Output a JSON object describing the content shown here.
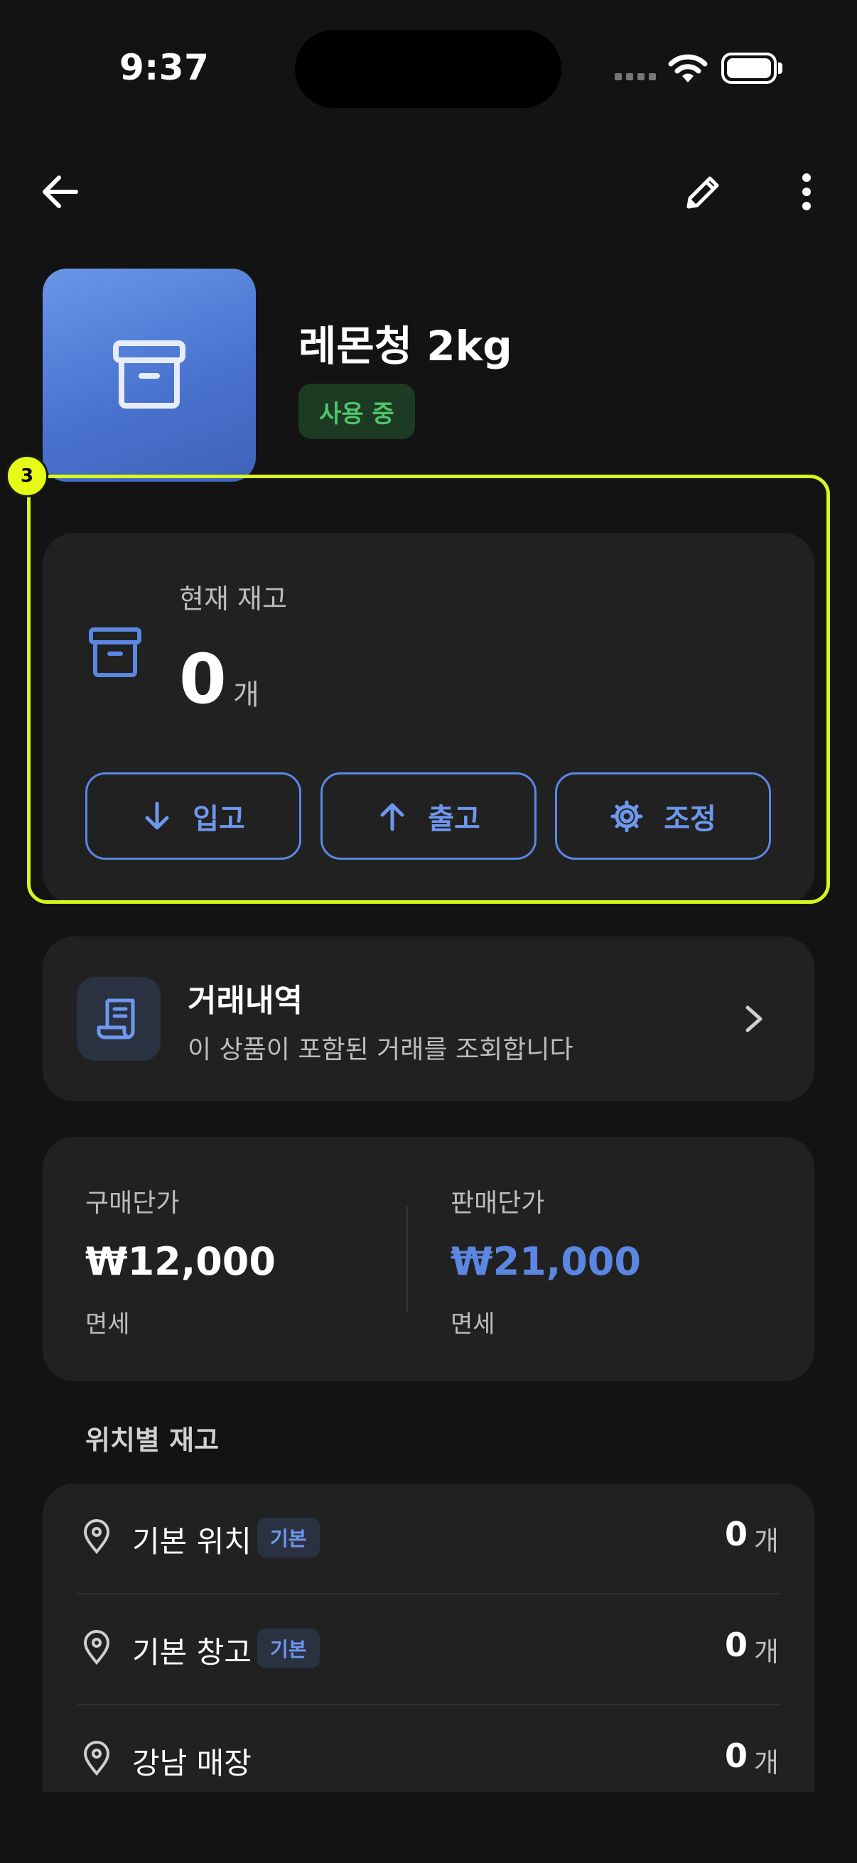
{
  "status_bar": {
    "time": "9:37"
  },
  "product": {
    "name": "레몬청 2kg",
    "status_badge": "사용 중"
  },
  "overlay": {
    "marker_number": "3"
  },
  "stock": {
    "label": "현재 재고",
    "value": "0",
    "unit": "개",
    "actions": [
      {
        "label": "입고",
        "icon": "arrow-down-icon"
      },
      {
        "label": "출고",
        "icon": "arrow-up-icon"
      },
      {
        "label": "조정",
        "icon": "gear-icon"
      }
    ]
  },
  "transactions": {
    "title": "거래내역",
    "subtitle": "이 상품이 포함된 거래를 조회합니다"
  },
  "prices": {
    "purchase": {
      "label": "구매단가",
      "value": "₩12,000",
      "note": "면세"
    },
    "sale": {
      "label": "판매단가",
      "value": "₩21,000",
      "note": "면세"
    }
  },
  "locations": {
    "title": "위치별 재고",
    "items": [
      {
        "name": "기본 위치",
        "tag": "기본",
        "qty": "0",
        "unit": "개"
      },
      {
        "name": "기본 창고",
        "tag": "기본",
        "qty": "0",
        "unit": "개"
      },
      {
        "name": "강남 매장",
        "tag": "",
        "qty": "0",
        "unit": "개"
      }
    ]
  },
  "colors": {
    "accent": "#5b87e3",
    "active_green": "#4fc36a",
    "highlight": "#d8f71b"
  }
}
